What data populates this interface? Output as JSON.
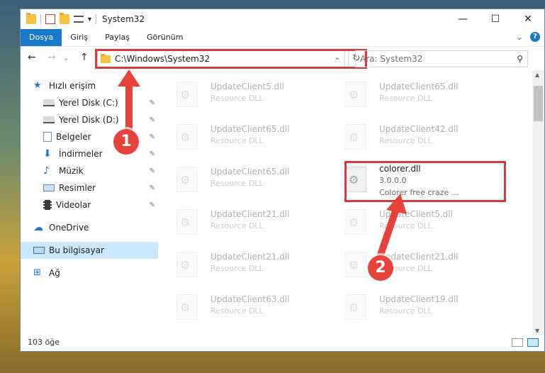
{
  "window": {
    "title": "System32",
    "quick_access_arrow": "▾",
    "buttons": {
      "minimize": "—",
      "maximize": "☐",
      "close": "✕"
    }
  },
  "ribbon": {
    "tabs": [
      {
        "label": "Dosya",
        "active": true
      },
      {
        "label": "Giriş"
      },
      {
        "label": "Paylaş"
      },
      {
        "label": "Görünüm"
      }
    ],
    "expand": "⌄",
    "help": "?"
  },
  "nav": {
    "back": "←",
    "forward": "→",
    "recent": "⌄",
    "up": "↑",
    "address": "C:\\Windows\\System32",
    "address_drop": "⌄",
    "refresh": "↻",
    "search_placeholder": "Ara: System32",
    "search_icon": "⚲"
  },
  "sidebar": {
    "items": [
      {
        "label": "Hızlı erişim",
        "icon": "star-icon"
      },
      {
        "label": "Yerel Disk (C:)",
        "icon": "drive-icon",
        "pinned": true
      },
      {
        "label": "Yerel Disk (D:)",
        "icon": "drive-icon",
        "pinned": true
      },
      {
        "label": "Belgeler",
        "icon": "document-icon",
        "pinned": true
      },
      {
        "label": "İndirmeler",
        "icon": "download-icon",
        "pinned": true
      },
      {
        "label": "Müzik",
        "icon": "music-icon",
        "pinned": true
      },
      {
        "label": "Resimler",
        "icon": "pictures-icon",
        "pinned": true
      },
      {
        "label": "Videolar",
        "icon": "video-icon",
        "pinned": true
      },
      {
        "label": "OneDrive",
        "icon": "cloud-icon"
      },
      {
        "label": "Bu bilgisayar",
        "icon": "computer-icon",
        "selected": true
      },
      {
        "label": "Ağ",
        "icon": "network-icon"
      }
    ],
    "pin_glyph": "📌"
  },
  "files": [
    {
      "name": "UpdateClient5.dll",
      "sub": "Resource DLL"
    },
    {
      "name": "UpdateClient65.dll",
      "sub": "Resource DLL"
    },
    {
      "name": "UpdateClient65.dll",
      "sub": "Resource DLL"
    },
    {
      "name": "UpdateClient42.dll",
      "sub": "Resource DLL"
    },
    {
      "name": "UpdateClient65.dll",
      "sub": "Resource DLL"
    },
    {
      "name": "colorer.dll",
      "sub": "3.0.0.0",
      "sub2": "Colorer free craze ..."
    },
    {
      "name": "UpdateClient21.dll",
      "sub": "Resource DLL"
    },
    {
      "name": "UpdateClient5.dll",
      "sub": "Resource DLL"
    },
    {
      "name": "UpdateClient21.dll",
      "sub": "Resource DLL"
    },
    {
      "name": "UpdateClient21.dll",
      "sub": "Resource DLL"
    },
    {
      "name": "UpdateClient63.dll",
      "sub": "Resource DLL"
    },
    {
      "name": "UpdateClient19.dll",
      "sub": "Resource DLL"
    }
  ],
  "status": {
    "count": "103 öğe"
  },
  "annotations": {
    "badge1": "1",
    "badge2": "2",
    "color": "#e8433a"
  }
}
